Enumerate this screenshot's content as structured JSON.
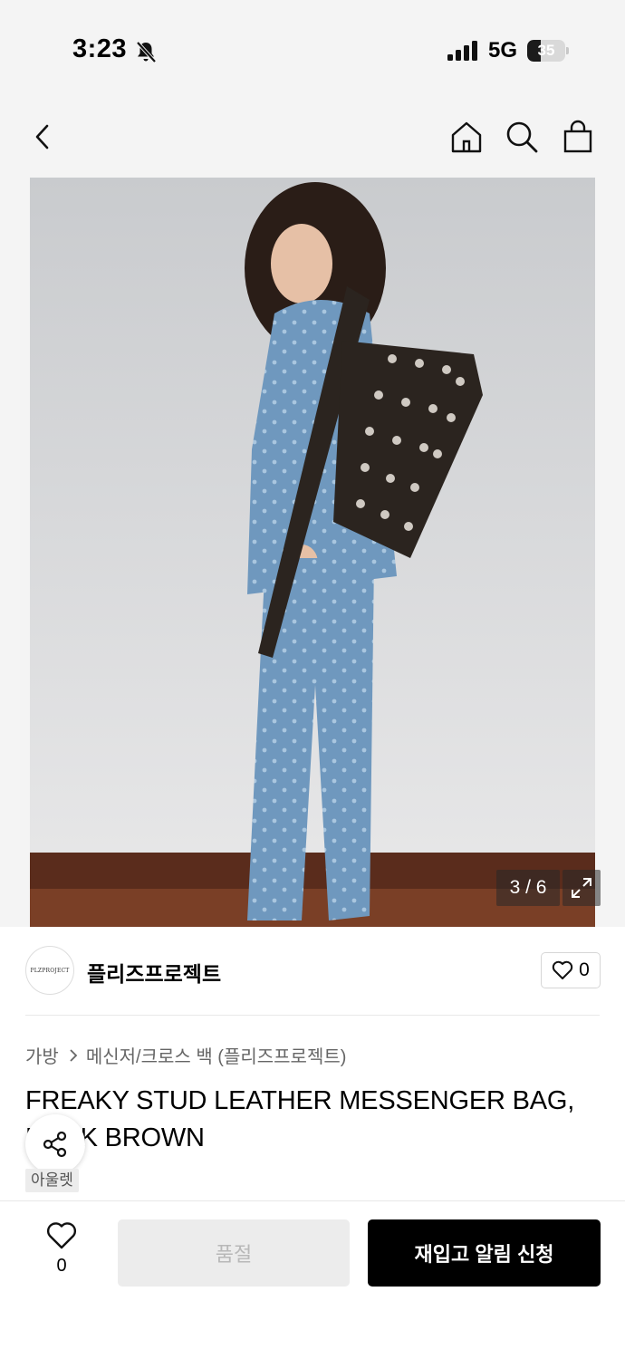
{
  "status_bar": {
    "time": "3:23",
    "network": "5G",
    "battery_level": "35",
    "battery_fraction": 0.35,
    "icons": [
      "bell-slash-icon",
      "signal-bars-icon",
      "battery-icon"
    ]
  },
  "header": {
    "icons": [
      "back-chevron-icon",
      "home-icon",
      "search-icon",
      "shopping-bag-icon"
    ]
  },
  "gallery": {
    "counter": "3 / 6",
    "current": 3,
    "total": 6,
    "expand_icon": "expand-arrows-icon"
  },
  "brand": {
    "logo_text": "PLZPROJECT",
    "name": "플리즈프로젝트",
    "like_count": "0"
  },
  "product": {
    "breadcrumb": [
      "가방",
      "메신저/크로스 백 (플리즈프로젝트)"
    ],
    "title": "FREAKY STUD LEATHER MESSENGER BAG, DARK BROWN",
    "tag": "아울렛"
  },
  "bottom_bar": {
    "wish_count": "0",
    "soldout_label": "품절",
    "restock_label": "재입고 알림 신청"
  },
  "colors": {
    "top_background": "#f4f4f4",
    "primary_button": "#000000",
    "disabled_button": "#ececec",
    "disabled_text": "#b8b8b8"
  }
}
